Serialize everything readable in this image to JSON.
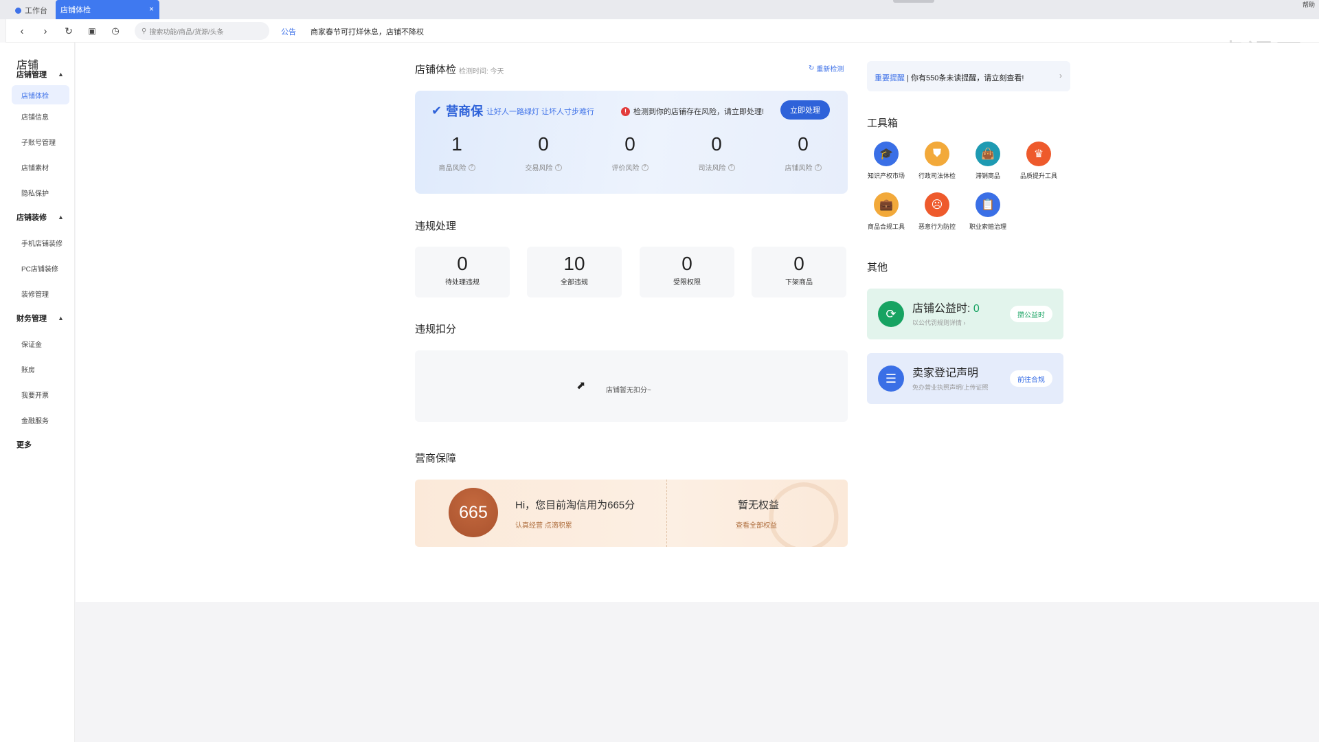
{
  "tabs": {
    "home_label": "工作台",
    "active_label": "店铺体检",
    "close_glyph": "×"
  },
  "toolbar": {
    "search_placeholder": "搜索功能/商品/货源/头条",
    "notice_label": "公告",
    "notice_text": "商家春节可打烊休息，店铺不降权",
    "watermark": "虎课网",
    "corner_text": "帮助"
  },
  "sidebar": {
    "title": "店铺",
    "groups": [
      {
        "label": "店铺管理",
        "items": [
          "店铺体检",
          "店铺信息",
          "子账号管理",
          "店铺素材",
          "隐私保护"
        ]
      },
      {
        "label": "店铺装修",
        "items": [
          "手机店铺装修",
          "PC店铺装修",
          "装修管理"
        ]
      },
      {
        "label": "财务管理",
        "items": [
          "保证金",
          "账房",
          "我要开票",
          "金融服务"
        ]
      }
    ],
    "more": "更多"
  },
  "health": {
    "title": "店铺体检",
    "meta": "检测时间: 今天",
    "recheck": "重新检测",
    "brand": "营商保",
    "slogan": "让好人一路绿灯 让坏人寸步难行",
    "alert": "检测到你的店铺存在风险，请立即处理!",
    "action": "立即处理",
    "stats": [
      {
        "value": "1",
        "label": "商品风险"
      },
      {
        "value": "0",
        "label": "交易风险"
      },
      {
        "value": "0",
        "label": "评价风险"
      },
      {
        "value": "0",
        "label": "司法风险"
      },
      {
        "value": "0",
        "label": "店铺风险"
      }
    ]
  },
  "violations": {
    "title": "违规处理",
    "boxes": [
      {
        "value": "0",
        "label": "待处理违规"
      },
      {
        "value": "10",
        "label": "全部违规"
      },
      {
        "value": "0",
        "label": "受限权限"
      },
      {
        "value": "0",
        "label": "下架商品"
      }
    ]
  },
  "deduct": {
    "title": "违规扣分",
    "empty": "店铺暂无扣分~"
  },
  "guarantee": {
    "title": "营商保障",
    "score": "665",
    "credit_text": "Hi，您目前淘信用为665分",
    "credit_sub": "认真经营 点滴积累",
    "no_rights": "暂无权益",
    "view_all": "查看全部权益"
  },
  "reminder": {
    "highlight": "重要提醒",
    "text": " | 你有550条未读提醒，请立刻查看!",
    "arrow": "›"
  },
  "toolbox": {
    "title": "工具箱",
    "tools": [
      {
        "label": "知识产权市场",
        "icon": "graduation-cap-icon",
        "glyph": "🎓",
        "color": "#3a6fe6"
      },
      {
        "label": "行政司法体检",
        "icon": "shield-icon",
        "glyph": "⛊",
        "color": "#f2a93a"
      },
      {
        "label": "滞销商品",
        "icon": "bag-icon",
        "glyph": "👜",
        "color": "#1e9ab2"
      },
      {
        "label": "品质提升工具",
        "icon": "crown-icon",
        "glyph": "♛",
        "color": "#ee5a2c"
      },
      {
        "label": "商品合规工具",
        "icon": "briefcase-icon",
        "glyph": "💼",
        "color": "#f2a93a"
      },
      {
        "label": "恶意行为防控",
        "icon": "frown-icon",
        "glyph": "☹",
        "color": "#ee5a2c"
      },
      {
        "label": "职业索赔治理",
        "icon": "clipboard-icon",
        "glyph": "📋",
        "color": "#3a6fe6"
      }
    ]
  },
  "others": {
    "title": "其他",
    "charity": {
      "title": "店铺公益时: ",
      "value": "0",
      "sub": "以公代罚规则详情 ›",
      "button": "攒公益时",
      "bg": "#e2f4ec",
      "accent": "#17a362"
    },
    "declare": {
      "title": "卖家登记声明",
      "sub": "免办营业执照声明/上传证照",
      "button": "前往合规",
      "bg": "#e5ecfb",
      "accent": "#3a6fe6"
    }
  },
  "colors": {
    "primary": "#3f72e8",
    "danger": "#e23b3b"
  }
}
